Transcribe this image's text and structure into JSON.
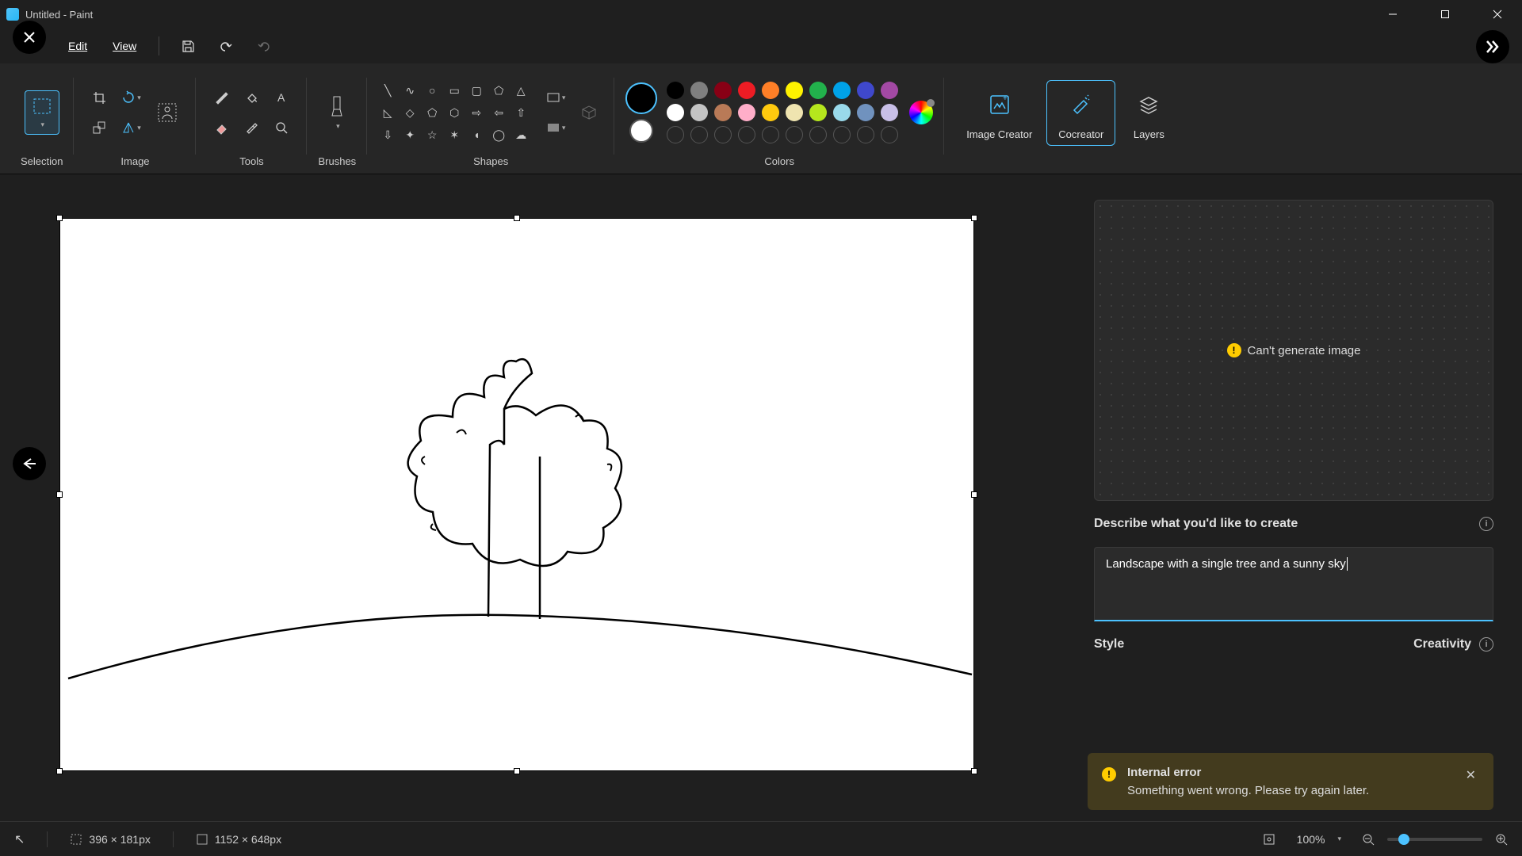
{
  "window": {
    "title": "Untitled - Paint"
  },
  "menu": {
    "edit": "Edit",
    "view": "View"
  },
  "ribbon": {
    "selection": "Selection",
    "image": "Image",
    "tools": "Tools",
    "brushes": "Brushes",
    "shapes": "Shapes",
    "colors": "Colors",
    "image_creator": "Image Creator",
    "cocreator": "Cocreator",
    "layers": "Layers"
  },
  "colors": {
    "primary": "#000000",
    "secondary": "#ffffff",
    "row1": [
      "#000000",
      "#7f7f7f",
      "#880015",
      "#ed1c24",
      "#ff7f27",
      "#fff200",
      "#22b14c",
      "#00a2e8",
      "#3f48cc",
      "#a349a4"
    ],
    "row2": [
      "#ffffff",
      "#c3c3c3",
      "#b97a57",
      "#ffaec9",
      "#ffc90e",
      "#efe4b0",
      "#b5e61d",
      "#99d9ea",
      "#7092be",
      "#c8bfe7"
    ]
  },
  "panel": {
    "preview_error": "Can't generate image",
    "describe_label": "Describe what you'd like to create",
    "prompt_value": "Landscape with a single tree and a sunny sky",
    "style_label": "Style",
    "creativity_label": "Creativity"
  },
  "toast": {
    "title": "Internal error",
    "body": "Something went wrong. Please try again later."
  },
  "status": {
    "cursor_icon": "↖",
    "selection_size": "396 × 181px",
    "canvas_size": "1152 × 648px",
    "zoom": "100%"
  },
  "chart_data": null
}
